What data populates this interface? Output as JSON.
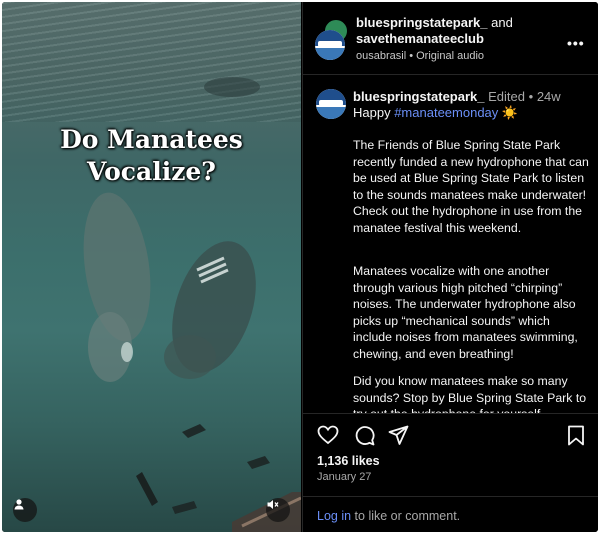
{
  "video": {
    "caption_line1": "Do Manatees",
    "caption_line2": "Vocalize?"
  },
  "header": {
    "account1": "bluespringstatepark_",
    "and_text": "and",
    "account2": "savethemanateeclub",
    "audio_user": "ousabrasil",
    "audio_sep": "•",
    "audio_label": "Original audio",
    "more_label": "•••"
  },
  "post": {
    "username": "bluespringstatepark_",
    "edited": "Edited",
    "dot": "•",
    "age": "24w",
    "greeting": "Happy",
    "hashtag": "#manateemonday",
    "emoji": "☀️",
    "paragraphs": [
      "The Friends of Blue Spring State Park recently funded a new hydrophone that can be used at Blue Spring State Park to listen to the sounds manatees make underwater! Check out the hydrophone in use from the manatee festival this weekend.",
      "Manatees vocalize with one another through various high pitched “chirping” noises. The underwater hydrophone also picks up “mechanical sounds” which include noises from manatees swimming, chewing, and even breathing!",
      "Did you know manatees make so many sounds? Stop by Blue Spring State Park to try out the hydrophone for yourself."
    ]
  },
  "stats": {
    "likes": "1,136 likes",
    "date": "January 27"
  },
  "footer": {
    "login": "Log in",
    "rest": "to like or comment."
  },
  "icons": {
    "like": "heart-icon",
    "comment": "comment-icon",
    "share": "send-icon",
    "save": "bookmark-icon",
    "mute": "mute-icon",
    "profile": "user-icon"
  }
}
